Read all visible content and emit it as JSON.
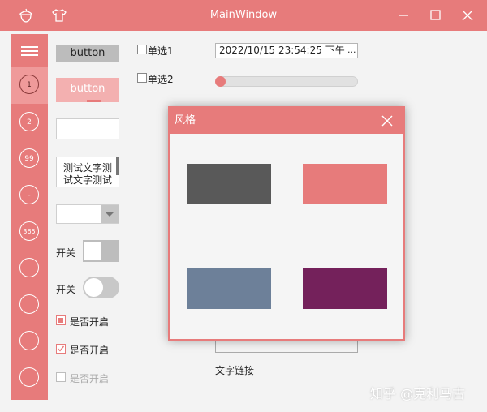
{
  "window": {
    "title": "MainWindow",
    "colors": {
      "accent": "#e77b7b",
      "background": "#f3f3f3"
    }
  },
  "nav": {
    "items": [
      "1",
      "2",
      "99",
      "-",
      "365",
      "",
      "",
      "",
      ""
    ]
  },
  "controls": {
    "button_label": "button",
    "button_disabled_label": "button",
    "textarea_text": "测试文字测试文字测试",
    "switch1_label": "开关",
    "switch2_label": "开关",
    "checkbox1_label": "是否开启",
    "checkbox2_label": "是否开启",
    "checkbox3_label": "是否开启",
    "radio1_label": "单选1",
    "radio2_label": "单选2",
    "datetime_value": "2022/10/15 23:54:25 下午",
    "datetime_ellipsis": "...",
    "slider_value": 0,
    "link_text": "文字链接"
  },
  "dialog": {
    "title": "风格",
    "swatches": [
      "#595959",
      "#e77b7b",
      "#6d8099",
      "#74215b"
    ]
  },
  "watermark": "知乎 @克利马古"
}
